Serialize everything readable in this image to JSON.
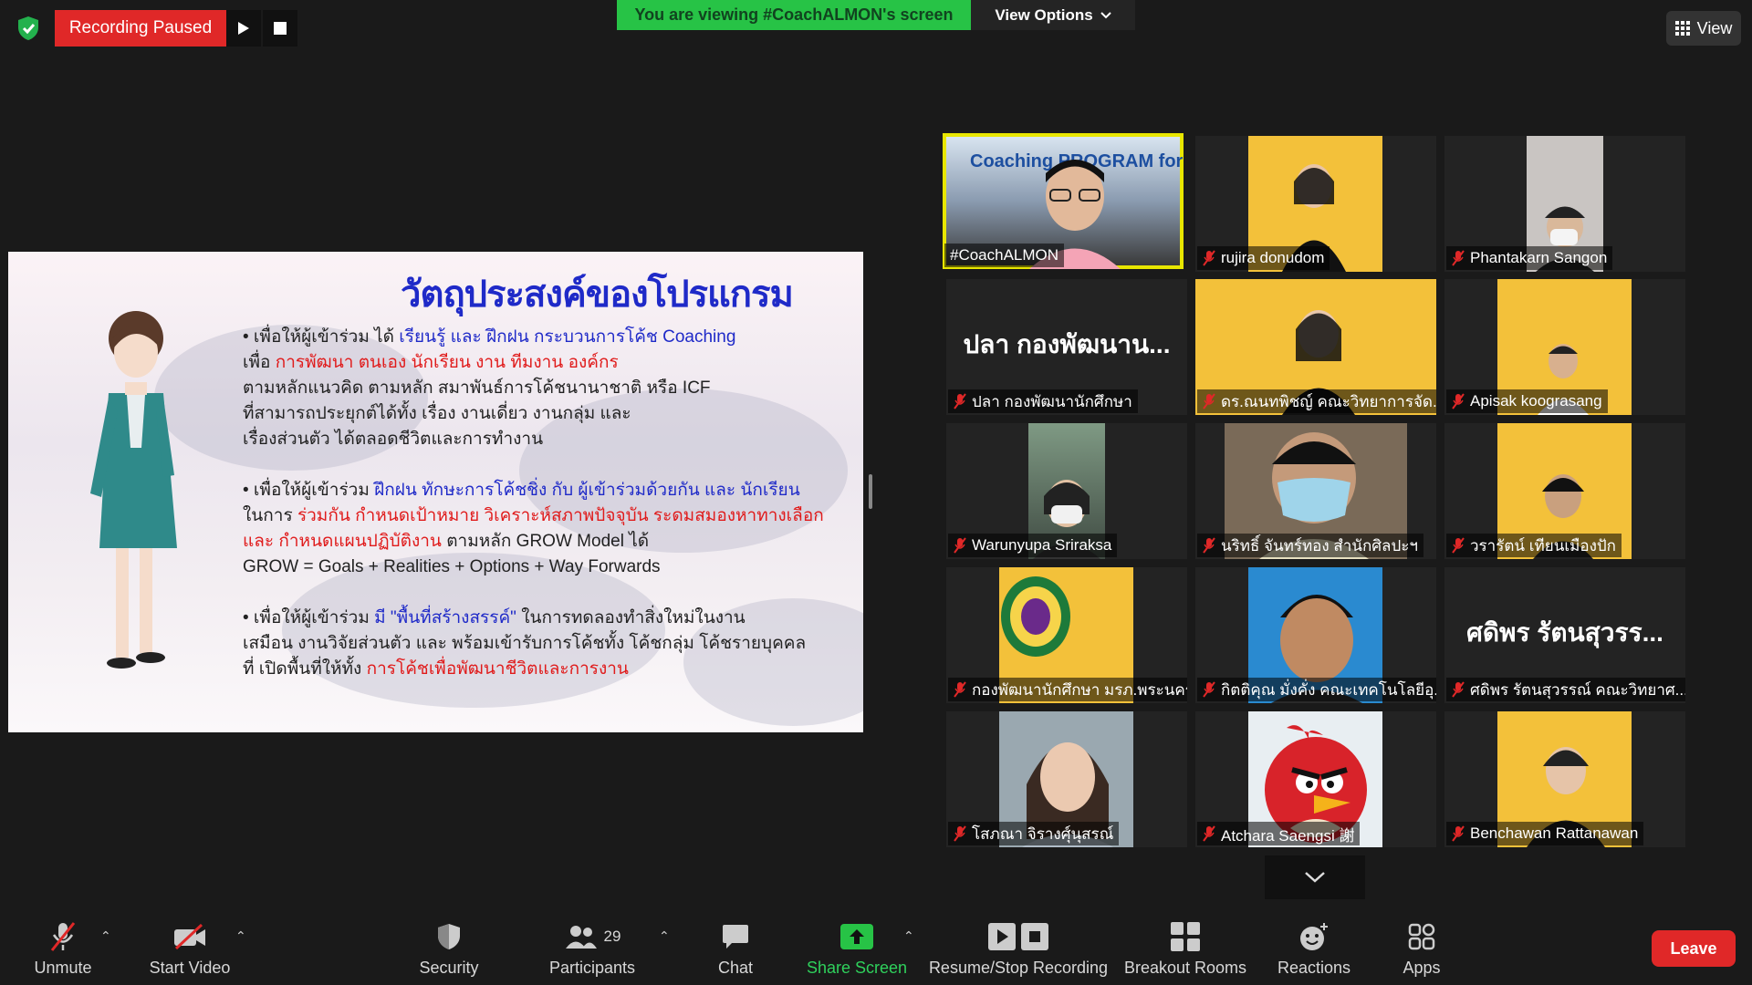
{
  "colors": {
    "accent_green": "#27c346",
    "recording_red": "#e02828",
    "active_speaker": "#e8e600",
    "slide_blue": "#1f2ac8",
    "slide_red": "#e01b1b"
  },
  "top": {
    "recording_status": "Recording Paused",
    "viewing_banner": "You are viewing #CoachALMON's screen",
    "view_options": "View Options",
    "view_button": "View"
  },
  "slide": {
    "title": "วัตถุประสงค์ของโปรแกรม",
    "p1": {
      "l1a": "• เพื่อให้ผู้เข้าร่วม ได้ ",
      "l1b": "เรียนรู้ และ ฝึกฝน กระบวนการโค้ช Coaching",
      "l2a": "เพื่อ ",
      "l2b": "การพัฒนา ตนเอง นักเรียน งาน ทีมงาน องค์กร",
      "l3": "ตามหลักแนวคิด ตามหลัก สมาพันธ์การโค้ชนานาชาติ หรือ ICF",
      "l4": "ที่สามารถประยุกต์ได้ทั้ง เรื่อง งานเดี่ยว งานกลุ่ม และ",
      "l5": "เรื่องส่วนตัว ได้ตลอดชีวิตและการทำงาน"
    },
    "p2": {
      "l1a": "• เพื่อให้ผู้เข้าร่วม ",
      "l1b": "ฝึกฝน ทักษะการโค้ชชิ่ง กับ ผู้เข้าร่วมด้วยกัน และ นักเรียน",
      "l2a": "ในการ ",
      "l2b": "ร่วมกัน กำหนดเป้าหมาย วิเคราะห์สภาพปัจจุบัน ระดมสมองหาทางเลือก",
      "l3a": "และ กำหนดแผนปฏิบัติงาน",
      "l3b": " ตามหลัก GROW Model ได้",
      "l4": "GROW = Goals + Realities + Options + Way Forwards"
    },
    "p3": {
      "l1a": "• เพื่อให้ผู้เข้าร่วม ",
      "l1b": "มี \"พื้นที่สร้างสรรค์\"",
      "l1c": " ในการทดลองทำสิ่งใหม่ในงาน",
      "l2": "เสมือน งานวิจัยส่วนตัว และ พร้อมเข้ารับการโค้ชทั้ง โค้ชกลุ่ม โค้ชรายบุคคล",
      "l3a": "ที่ เปิดพื้นที่ให้ทั้ง ",
      "l3b": "การโค้ชเพื่อพัฒนาชีวิตและการงาน"
    }
  },
  "gallery": [
    {
      "name": "#CoachALMON",
      "muted": false,
      "active": true,
      "thumb_text": "Coaching PROGRAM for"
    },
    {
      "name": "rujira donudom",
      "muted": true
    },
    {
      "name": "Phantakarn Sangon",
      "muted": true
    },
    {
      "name": "ปลา กองพัฒนานักศึกษา",
      "muted": true,
      "big": "ปลา กองพัฒนาน..."
    },
    {
      "name": "ดร.ณนทพิชญ์ คณะวิทยาการจัด...",
      "muted": true
    },
    {
      "name": "Apisak koograsang",
      "muted": true
    },
    {
      "name": "Warunyupa Sriraksa",
      "muted": true
    },
    {
      "name": "นริทธิ์ จันทร์ทอง สำนักศิลปะฯ",
      "muted": true
    },
    {
      "name": "วรารัตน์ เทียนเมืองปัก",
      "muted": true
    },
    {
      "name": "กองพัฒนานักศึกษา มรภ.พระนคร",
      "muted": true
    },
    {
      "name": "กิตติคุณ มั่งคั่ง คณะเทคโนโลยีอุ...",
      "muted": true
    },
    {
      "name": "ศดิพร รัตนสุวรรณ์ คณะวิทยาศ...",
      "muted": true,
      "big": "ศดิพร รัตนสุวรร..."
    },
    {
      "name": "โสภณา จิรางศุ์นุสรณ์",
      "muted": true
    },
    {
      "name": "Atchara Saengsi 謝",
      "muted": true
    },
    {
      "name": "Benchawan Rattanawan",
      "muted": true
    }
  ],
  "toolbar": {
    "unmute": "Unmute",
    "start_video": "Start Video",
    "security": "Security",
    "participants": "Participants",
    "participant_count": "29",
    "chat": "Chat",
    "share_screen": "Share Screen",
    "recording": "Resume/Stop Recording",
    "breakout": "Breakout Rooms",
    "reactions": "Reactions",
    "apps": "Apps",
    "leave": "Leave"
  }
}
